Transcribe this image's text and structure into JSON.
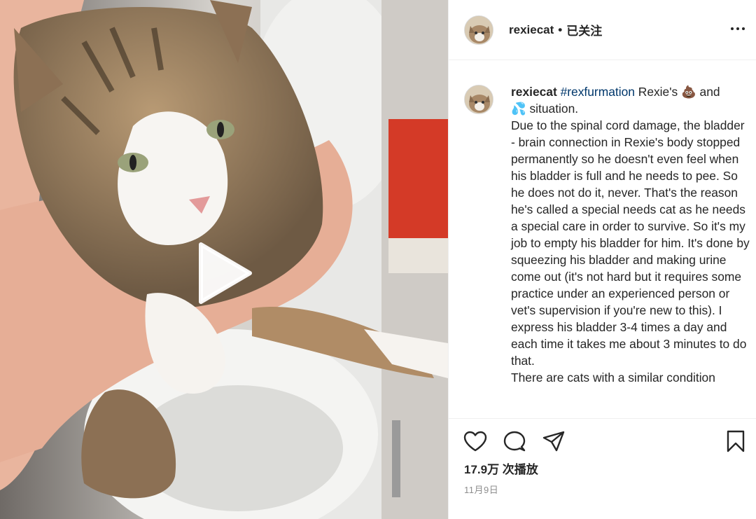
{
  "header": {
    "username": "rexiecat",
    "separator": "•",
    "follow_status": "已关注"
  },
  "caption": {
    "username": "rexiecat",
    "hashtag": "#rexfurmation",
    "line1_rest": " Rexie's 💩 and",
    "line2": "💦 situation.",
    "body": "Due to the spinal cord damage, the bladder - brain connection in Rexie's body stopped permanently so he doesn't even feel when his bladder is full and he needs to pee. So he does not do it, never. That's the reason he's called a special needs cat as he needs a special care in order to survive. So it's my job to empty his bladder for him. It's done by squeezing his bladder and making urine come out (it's not hard but it requires some practice under an experienced person or vet's supervision if you're new to this). I express his bladder 3-4 times a day and each time it takes me about 3 minutes to do that.",
    "overflow_line": "There are cats with a similar condition"
  },
  "stats": {
    "views": "17.9万 次播放",
    "date": "11月9日"
  },
  "icons": {
    "like": "heart-icon",
    "comment": "comment-icon",
    "share": "share-icon",
    "save": "bookmark-icon",
    "more": "more-icon",
    "play": "play-icon"
  }
}
